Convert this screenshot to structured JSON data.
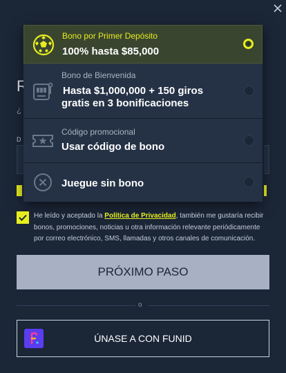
{
  "background": {
    "heading_fragment": "R",
    "sub_fragment": "¿",
    "label_fragment": "D"
  },
  "bonus_options": [
    {
      "category": "Bono por Primer Depósito",
      "title": "100% hasta $85,000",
      "icon": "soccer-ball-icon",
      "selected": true
    },
    {
      "category": "Bono de Bienvenida",
      "title_line1": "Hasta $1,000,000 + 150 giros",
      "title_line2": "gratis en 3 bonificaciones",
      "icon": "slot-machine-icon",
      "selected": false
    },
    {
      "category": "Código promocional",
      "title": "Usar código de bono",
      "icon": "ticket-star-icon",
      "selected": false
    },
    {
      "title": "Juegue sin bono",
      "icon": "no-bonus-icon",
      "selected": false
    }
  ],
  "consent": {
    "prefix": "He leído y aceptado la ",
    "link": "Política de Privacidad",
    "suffix": ", también me gustaría recibir bonos, promociones, noticias u otra información relevante periódicamente por correo electrónico, SMS, llamadas y otros canales de comunicación."
  },
  "next_button": "PRÓXIMO PASO",
  "divider_text": "o",
  "funid_button": "ÚNASE A CON FUNID",
  "colors": {
    "background": "#1b2637",
    "accent": "#e7ee1f",
    "button_disabled": "#a8b1c3"
  }
}
